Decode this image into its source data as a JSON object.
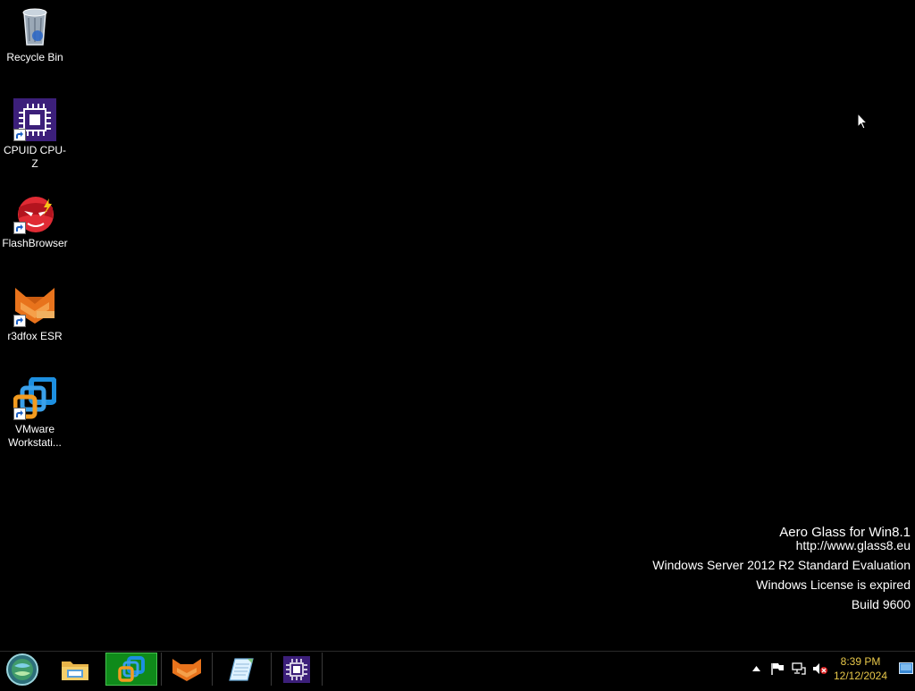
{
  "desktop": {
    "icons": [
      {
        "label": "Recycle Bin",
        "icon": "recycle-bin-icon"
      },
      {
        "label": "CPUID CPU-Z",
        "icon": "cpu-z-icon"
      },
      {
        "label": "FlashBrowser",
        "icon": "flashbrowser-icon"
      },
      {
        "label": "r3dfox ESR",
        "icon": "r3dfox-icon"
      },
      {
        "label": "VMware\nWorkstati...",
        "icon": "vmware-icon"
      }
    ]
  },
  "watermark": {
    "line1": "Aero Glass for Win8.1",
    "line2": "http://www.glass8.eu",
    "line3": "Windows Server 2012 R2 Standard Evaluation",
    "line4": "Windows License is expired",
    "line5": "Build 9600"
  },
  "taskbar": {
    "start": "start-orb-icon",
    "pinned": [
      {
        "icon": "file-explorer-icon",
        "active": false
      },
      {
        "icon": "vmware-icon",
        "active": true
      },
      {
        "icon": "r3dfox-icon",
        "active": false
      },
      {
        "icon": "notepad-icon",
        "active": false
      },
      {
        "icon": "cpu-z-icon",
        "active": false
      }
    ],
    "tray": {
      "time": "8:39 PM",
      "date": "12/12/2024"
    }
  },
  "colors": {
    "background": "#000000",
    "active_taskbar_button": "#0f8a1a",
    "clock_text": "#e8c84a"
  }
}
